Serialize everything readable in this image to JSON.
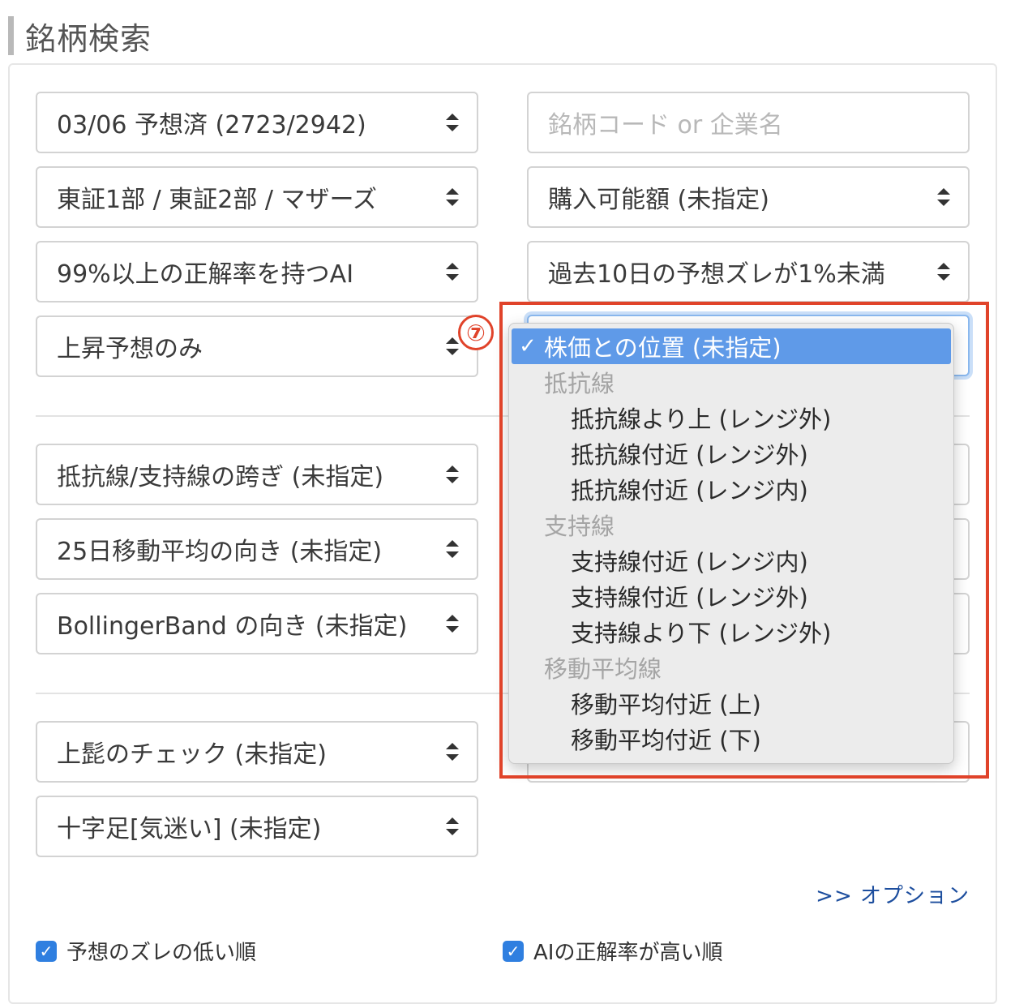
{
  "heading": "銘柄検索",
  "left_selects": [
    "03/06 予想済 (2723/2942)",
    "東証1部 / 東証2部 / マザーズ",
    "99%以上の正解率を持つAI",
    "上昇予想のみ",
    "抵抗線/支持線の跨ぎ (未指定)",
    "25日移動平均の向き (未指定)",
    "BollingerBand の向き (未指定)",
    "上髭のチェック (未指定)",
    "十字足[気迷い] (未指定)"
  ],
  "search": {
    "placeholder": "銘柄コード or 企業名"
  },
  "right_selects": [
    "購入可能額 (未指定)",
    "過去10日の予想ズレが1%未満"
  ],
  "annotation": {
    "badge": "⑦",
    "accent": "#e0432a"
  },
  "dropdown": {
    "check_mark": "✓",
    "selected": "株価との位置 (未指定)",
    "groups": [
      {
        "label": "抵抗線",
        "items": [
          "抵抗線より上 (レンジ外)",
          "抵抗線付近 (レンジ外)",
          "抵抗線付近 (レンジ内)"
        ]
      },
      {
        "label": "支持線",
        "items": [
          "支持線付近 (レンジ内)",
          "支持線付近 (レンジ外)",
          "支持線より下 (レンジ外)"
        ]
      },
      {
        "label": "移動平均線",
        "items": [
          "移動平均付近 (上)",
          "移動平均付近 (下)"
        ]
      }
    ]
  },
  "options_link": ">> オプション",
  "checkboxes": [
    {
      "label": "予想のズレの低い順",
      "checked": true
    },
    {
      "label": "AIの正解率が高い順",
      "checked": true
    }
  ],
  "colors": {
    "selection": "#5f9ae8",
    "link": "#1d4e9e",
    "checkbox": "#2f7fe0"
  }
}
